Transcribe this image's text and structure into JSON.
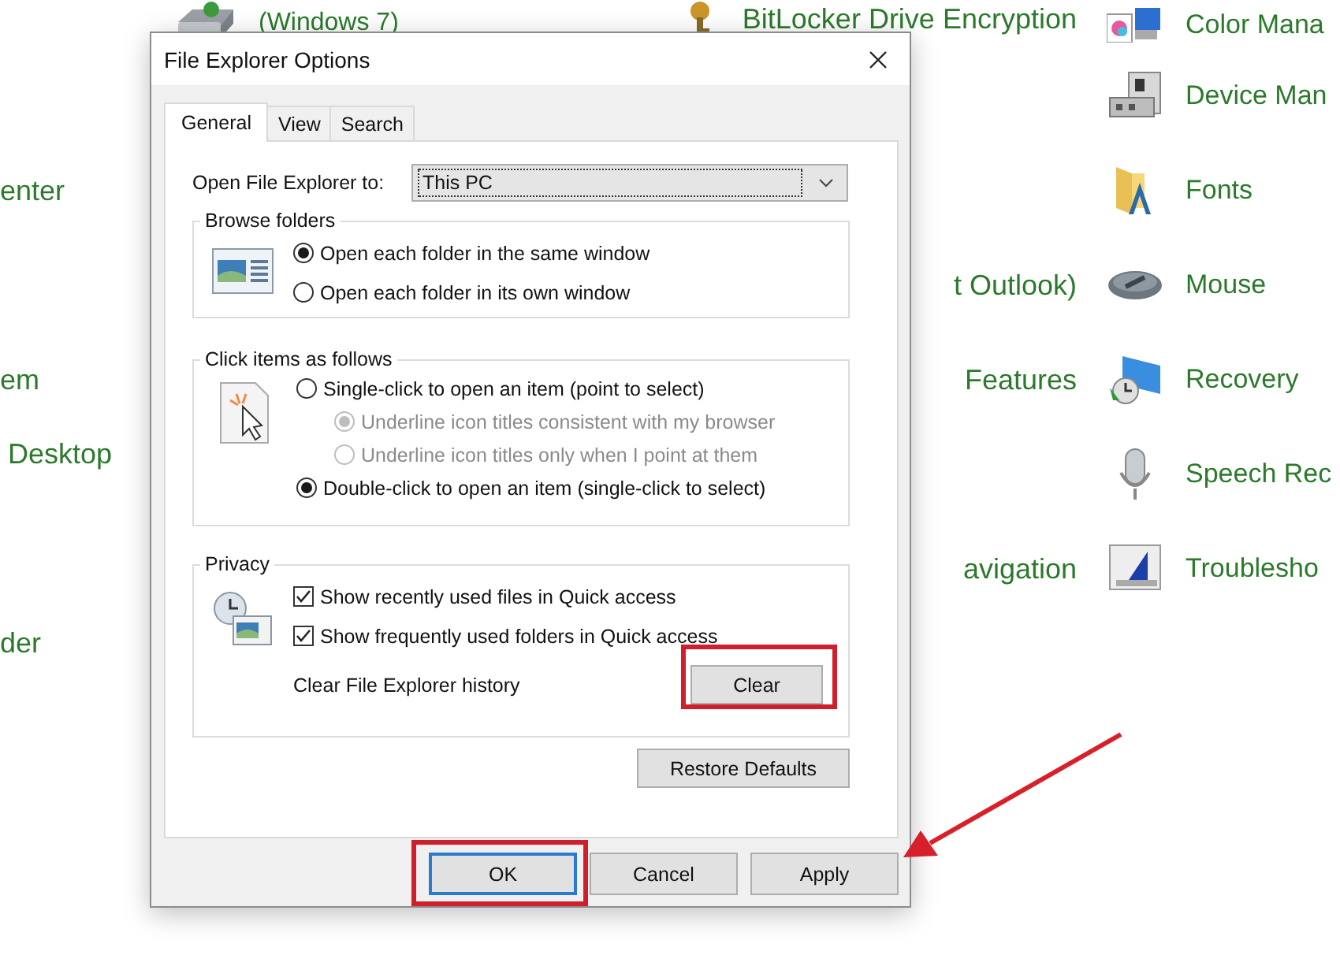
{
  "control_panel": {
    "column_1": [
      "enter",
      "em",
      "Desktop",
      "der"
    ],
    "column_2": [
      "(Windows 7)"
    ],
    "column_3": [
      "BitLocker Drive Encryption",
      "t Outlook)",
      "Features",
      "avigation"
    ],
    "column_4": [
      "Color Mana",
      "Device Man",
      "Fonts",
      "Mouse",
      "Recovery",
      "Speech Rec",
      "Troublesho"
    ]
  },
  "dialog": {
    "title": "File Explorer Options",
    "tabs": [
      {
        "label": "General",
        "selected": true
      },
      {
        "label": "View",
        "selected": false
      },
      {
        "label": "Search",
        "selected": false
      }
    ],
    "open_to": {
      "label": "Open File Explorer to:",
      "value": "This PC"
    },
    "browse_folders": {
      "title": "Browse folders",
      "options": [
        {
          "label": "Open each folder in the same window",
          "selected": true
        },
        {
          "label": "Open each folder in its own window",
          "selected": false
        }
      ]
    },
    "click_items": {
      "title": "Click items as follows",
      "options": [
        {
          "label": "Single-click to open an item (point to select)",
          "selected": false,
          "disabled": false,
          "children": [
            {
              "label": "Underline icon titles consistent with my browser",
              "selected": true,
              "disabled": true
            },
            {
              "label": "Underline icon titles only when I point at them",
              "selected": false,
              "disabled": true
            }
          ]
        },
        {
          "label": "Double-click to open an item (single-click to select)",
          "selected": true,
          "disabled": false
        }
      ]
    },
    "privacy": {
      "title": "Privacy",
      "checkboxes": [
        {
          "label": "Show recently used files in Quick access",
          "checked": true
        },
        {
          "label": "Show frequently used folders in Quick access",
          "checked": true
        }
      ],
      "clear_label": "Clear File Explorer history",
      "clear_button": "Clear"
    },
    "restore_button": "Restore Defaults",
    "buttons": [
      {
        "label": "OK",
        "default": true
      },
      {
        "label": "Cancel",
        "default": false
      },
      {
        "label": "Apply",
        "default": false
      }
    ]
  }
}
